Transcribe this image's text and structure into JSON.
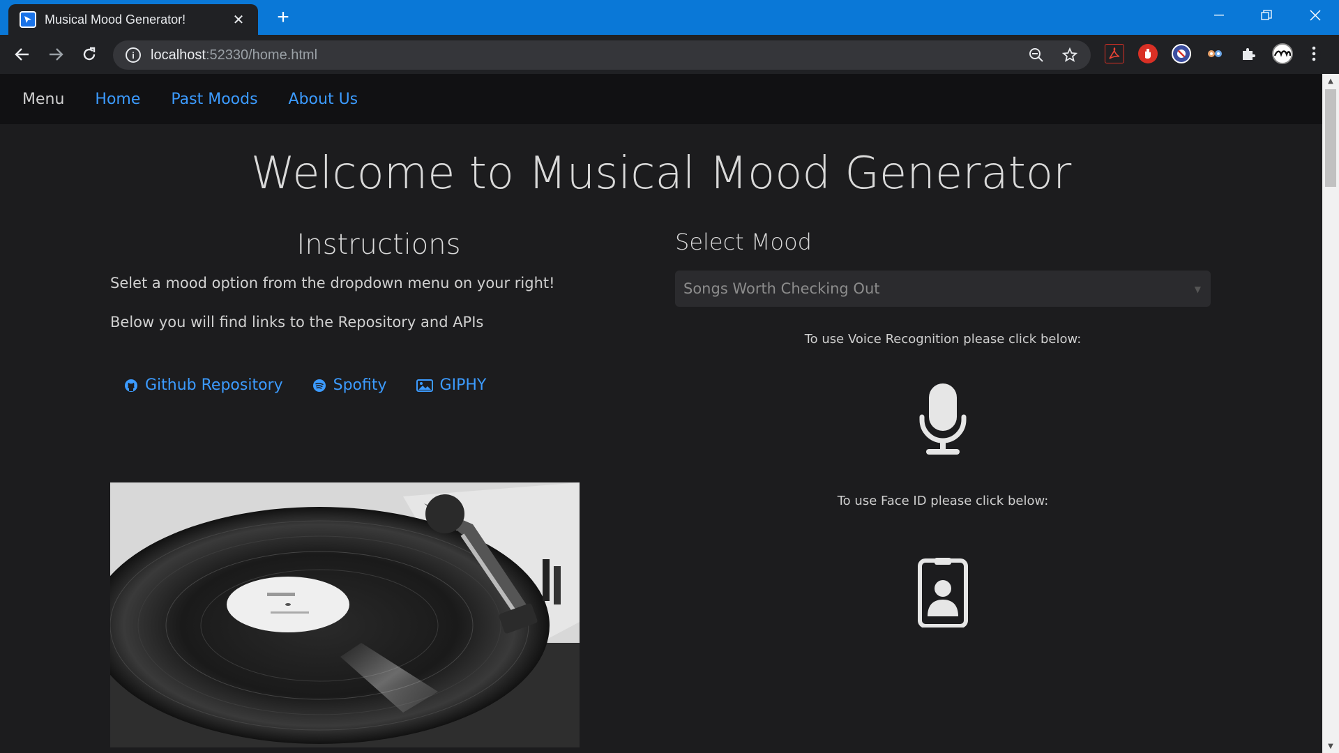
{
  "browser": {
    "tab_title": "Musical Mood Generator!",
    "tab_close": "✕",
    "new_tab": "+",
    "url_host": "localhost",
    "url_rest": ":52330/home.html",
    "window_controls": [
      "minimize",
      "restore",
      "close"
    ]
  },
  "navbar": {
    "brand": "Menu",
    "links": [
      "Home",
      "Past Moods",
      "About Us"
    ]
  },
  "main": {
    "heading": "Welcome to Musical Mood Generator"
  },
  "instructions": {
    "title": "Instructions",
    "line1": "Selet a mood option from the dropdown menu on your right!",
    "line2": "Below you will find links to the Repository and APIs",
    "links": [
      {
        "label": "Github Repository",
        "icon": "github-icon"
      },
      {
        "label": "Spofity",
        "icon": "spotify-icon"
      },
      {
        "label": "GIPHY",
        "icon": "image-icon"
      }
    ]
  },
  "mood": {
    "title": "Select Mood",
    "select_value": "Songs Worth Checking Out",
    "voice_hint": "To use Voice Recognition please click below:",
    "face_hint": "To use Face ID please click below:"
  },
  "colors": {
    "accent": "#3c9bff",
    "page_bg": "#1c1c1e",
    "navbar_bg": "#111113",
    "tabbar": "#0a78d7"
  }
}
